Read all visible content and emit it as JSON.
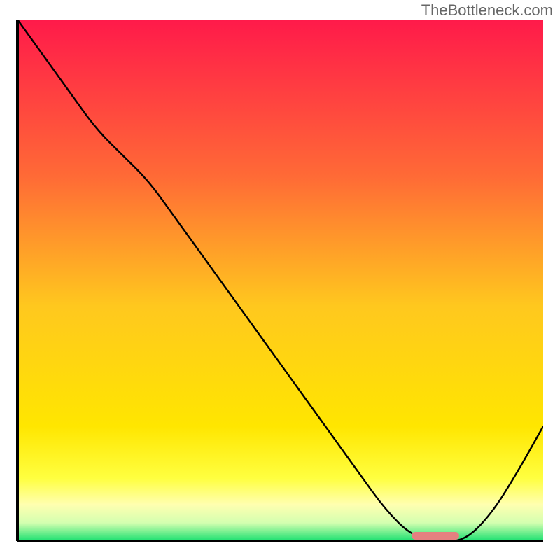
{
  "watermark": "TheBottleneck.com",
  "chart_data": {
    "type": "line",
    "title": "",
    "xlabel": "",
    "ylabel": "",
    "x": [
      0,
      5,
      10,
      15,
      20,
      25,
      30,
      35,
      40,
      45,
      50,
      55,
      60,
      65,
      70,
      75,
      80,
      85,
      90,
      95,
      100
    ],
    "values": [
      100,
      93,
      86,
      79,
      74,
      69,
      62,
      55,
      48,
      41,
      34,
      27,
      20,
      13,
      6,
      1,
      0,
      0,
      5,
      13,
      22
    ],
    "ylim": [
      0,
      100
    ],
    "xlim": [
      0,
      100
    ],
    "background_gradient": {
      "top": "#ff1a4a",
      "mid_upper": "#ff8030",
      "mid_lower": "#ffe000",
      "low_band": "#ffff99",
      "bottom": "#1ae070"
    },
    "optimal_marker": {
      "x_start": 75,
      "x_end": 84,
      "color": "#e58080"
    },
    "axis_color": "#000000",
    "line_color": "#000000"
  }
}
